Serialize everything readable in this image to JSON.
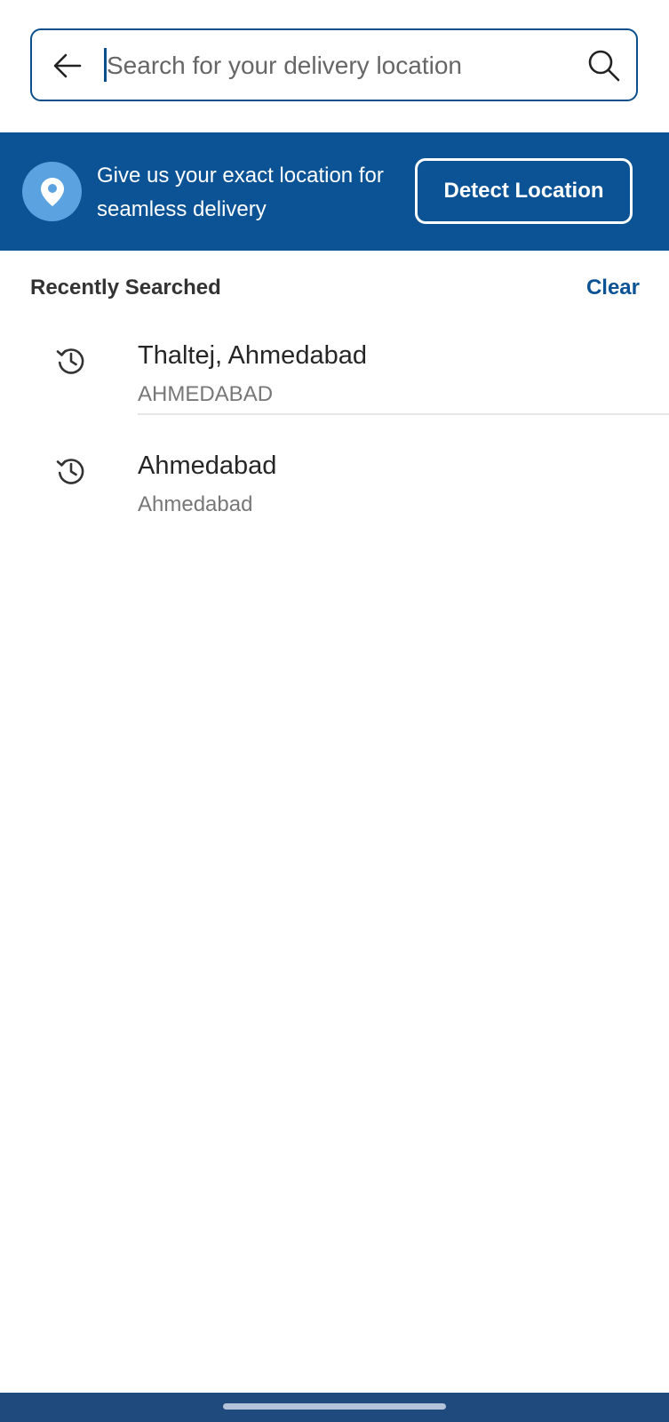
{
  "search": {
    "placeholder": "Search for your delivery location",
    "value": ""
  },
  "banner": {
    "message_line1": "Give us your exact location for",
    "message_line2": "seamless delivery",
    "detect_label": "Detect Location",
    "background_color": "#0b5394",
    "pin_circle_color": "#5ba3e0"
  },
  "recent": {
    "title": "Recently Searched",
    "clear_label": "Clear",
    "items": [
      {
        "title": "Thaltej, Ahmedabad",
        "subtitle": "AHMEDABAD",
        "icon": "history-icon"
      },
      {
        "title": "Ahmedabad",
        "subtitle": "Ahmedabad",
        "icon": "history-icon"
      }
    ]
  },
  "colors": {
    "accent": "#0b5394",
    "bottom_bar": "#1f4a7e"
  }
}
